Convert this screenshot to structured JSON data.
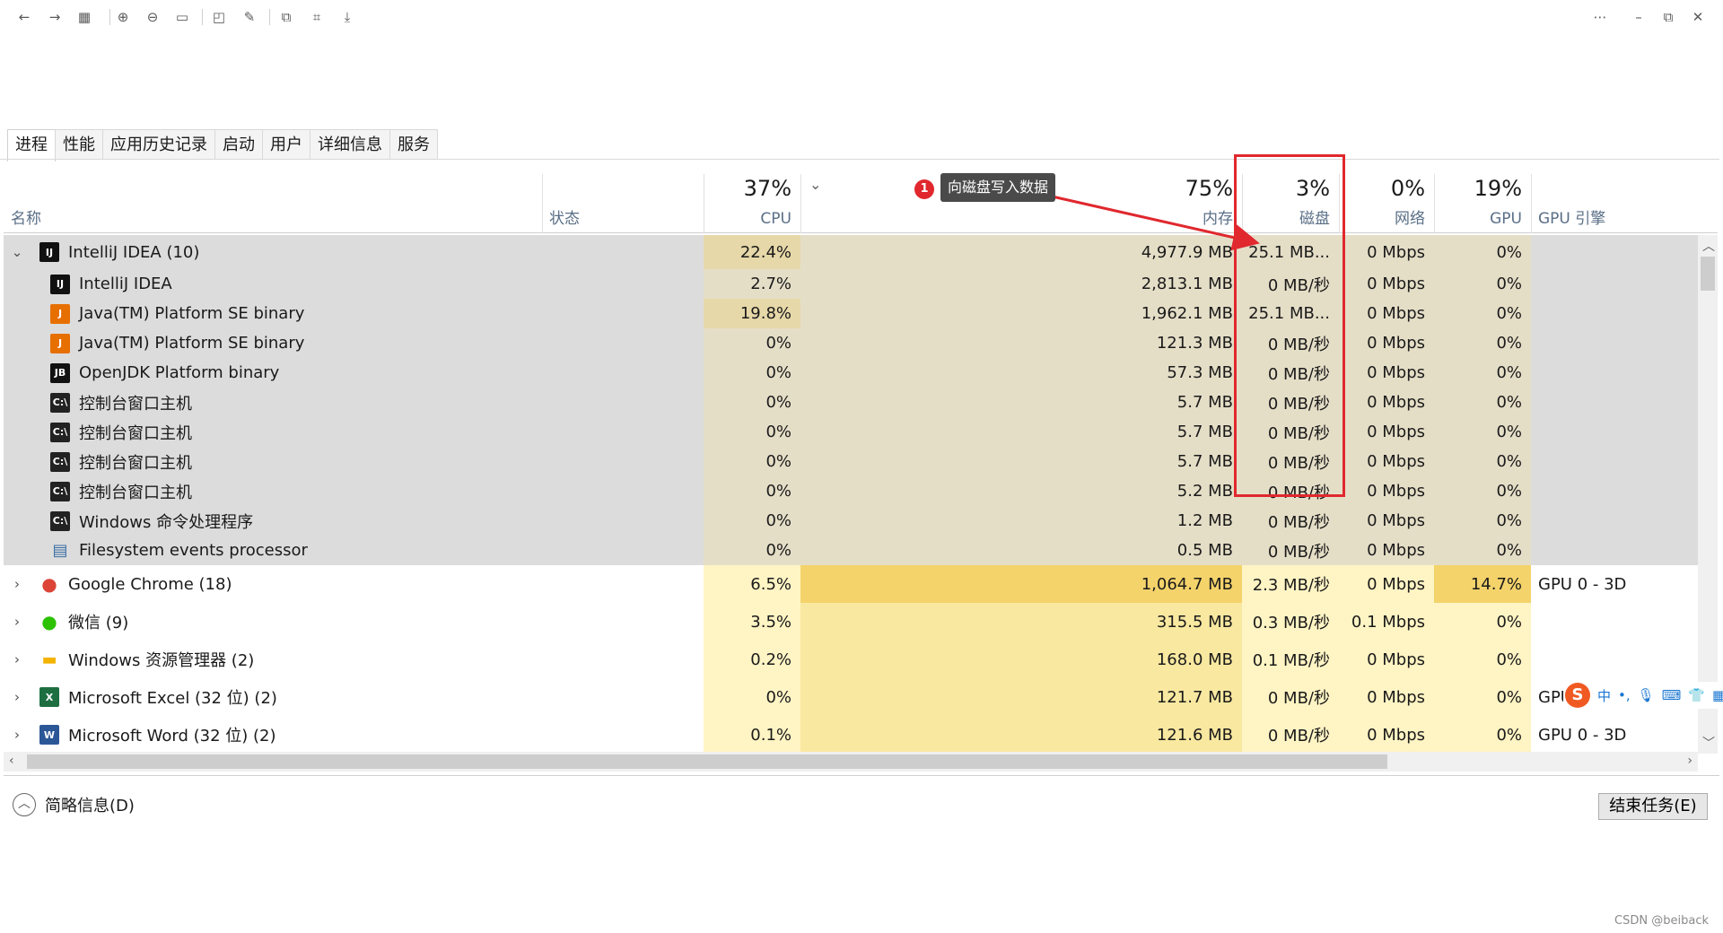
{
  "toolbar": {
    "icons": [
      "back-icon",
      "forward-icon",
      "grid-icon",
      "zoom-in-icon",
      "zoom-out-icon",
      "fit-icon",
      "open-icon",
      "edit-icon",
      "copy-icon",
      "capture-icon",
      "save-icon"
    ],
    "more": "⋯",
    "minimize": "–",
    "restore": "⧉",
    "close": "✕"
  },
  "tabs": [
    "进程",
    "性能",
    "应用历史记录",
    "启动",
    "用户",
    "详细信息",
    "服务"
  ],
  "header": {
    "name": "名称",
    "status": "状态",
    "cpu_pct": "37%",
    "cpu": "CPU",
    "mem_pct": "75%",
    "mem": "内存",
    "disk_pct": "3%",
    "disk": "磁盘",
    "net_pct": "0%",
    "net": "网络",
    "gpu_pct": "19%",
    "gpu": "GPU",
    "gpu_engine": "GPU 引擎"
  },
  "rows": [
    {
      "kind": "group",
      "expanded": true,
      "icon": "intellij-icon",
      "name": "IntelliJ IDEA (10)",
      "cpu": "22.4%",
      "mem": "4,977.9 MB",
      "disk": "25.1 MB...",
      "net": "0 Mbps",
      "gpu": "0%",
      "engine": ""
    },
    {
      "kind": "child",
      "icon": "intellij-icon",
      "name": "IntelliJ IDEA",
      "cpu": "2.7%",
      "mem": "2,813.1 MB",
      "disk": "0 MB/秒",
      "net": "0 Mbps",
      "gpu": "0%",
      "engine": ""
    },
    {
      "kind": "child",
      "icon": "java-icon",
      "name": "Java(TM) Platform SE binary",
      "cpu": "19.8%",
      "mem": "1,962.1 MB",
      "disk": "25.1 MB...",
      "net": "0 Mbps",
      "gpu": "0%",
      "engine": ""
    },
    {
      "kind": "child",
      "icon": "java-icon",
      "name": "Java(TM) Platform SE binary",
      "cpu": "0%",
      "mem": "121.3 MB",
      "disk": "0 MB/秒",
      "net": "0 Mbps",
      "gpu": "0%",
      "engine": ""
    },
    {
      "kind": "child",
      "icon": "jb-icon",
      "name": "OpenJDK Platform binary",
      "cpu": "0%",
      "mem": "57.3 MB",
      "disk": "0 MB/秒",
      "net": "0 Mbps",
      "gpu": "0%",
      "engine": ""
    },
    {
      "kind": "child",
      "icon": "console-icon",
      "name": "控制台窗口主机",
      "cpu": "0%",
      "mem": "5.7 MB",
      "disk": "0 MB/秒",
      "net": "0 Mbps",
      "gpu": "0%",
      "engine": ""
    },
    {
      "kind": "child",
      "icon": "console-icon",
      "name": "控制台窗口主机",
      "cpu": "0%",
      "mem": "5.7 MB",
      "disk": "0 MB/秒",
      "net": "0 Mbps",
      "gpu": "0%",
      "engine": ""
    },
    {
      "kind": "child",
      "icon": "console-icon",
      "name": "控制台窗口主机",
      "cpu": "0%",
      "mem": "5.7 MB",
      "disk": "0 MB/秒",
      "net": "0 Mbps",
      "gpu": "0%",
      "engine": ""
    },
    {
      "kind": "child",
      "icon": "console-icon",
      "name": "控制台窗口主机",
      "cpu": "0%",
      "mem": "5.2 MB",
      "disk": "0 MB/秒",
      "net": "0 Mbps",
      "gpu": "0%",
      "engine": ""
    },
    {
      "kind": "child",
      "icon": "console-icon",
      "name": "Windows 命令处理程序",
      "cpu": "0%",
      "mem": "1.2 MB",
      "disk": "0 MB/秒",
      "net": "0 Mbps",
      "gpu": "0%",
      "engine": ""
    },
    {
      "kind": "child",
      "icon": "window-icon",
      "name": "Filesystem events processor",
      "cpu": "0%",
      "mem": "0.5 MB",
      "disk": "0 MB/秒",
      "net": "0 Mbps",
      "gpu": "0%",
      "engine": ""
    },
    {
      "kind": "group",
      "expanded": false,
      "icon": "chrome-icon",
      "name": "Google Chrome (18)",
      "cpu": "6.5%",
      "mem": "1,064.7 MB",
      "disk": "2.3 MB/秒",
      "net": "0 Mbps",
      "gpu": "14.7%",
      "engine": "GPU 0 - 3D"
    },
    {
      "kind": "group",
      "expanded": false,
      "icon": "wechat-icon",
      "name": "微信 (9)",
      "cpu": "3.5%",
      "mem": "315.5 MB",
      "disk": "0.3 MB/秒",
      "net": "0.1 Mbps",
      "gpu": "0%",
      "engine": ""
    },
    {
      "kind": "group",
      "expanded": false,
      "icon": "explorer-icon",
      "name": "Windows 资源管理器 (2)",
      "cpu": "0.2%",
      "mem": "168.0 MB",
      "disk": "0.1 MB/秒",
      "net": "0 Mbps",
      "gpu": "0%",
      "engine": ""
    },
    {
      "kind": "group",
      "expanded": false,
      "icon": "excel-icon",
      "name": "Microsoft Excel (32 位) (2)",
      "cpu": "0%",
      "mem": "121.7 MB",
      "disk": "0 MB/秒",
      "net": "0 Mbps",
      "gpu": "0%",
      "engine": "GPU"
    },
    {
      "kind": "group",
      "expanded": false,
      "icon": "word-icon",
      "name": "Microsoft Word (32 位) (2)",
      "cpu": "0.1%",
      "mem": "121.6 MB",
      "disk": "0 MB/秒",
      "net": "0 Mbps",
      "gpu": "0%",
      "engine": "GPU 0 - 3D"
    }
  ],
  "annotation": {
    "marker": "1",
    "tooltip": "向磁盘写入数据"
  },
  "footer": {
    "brief": "简略信息(D)",
    "end_task": "结束任务(E)"
  },
  "ime": {
    "logo": "S",
    "lang": "中",
    "punct": "•,",
    "items": [
      "mic-icon",
      "keyboard-icon",
      "shirt-icon",
      "apps-icon"
    ]
  },
  "watermark": "CSDN @beiback",
  "colors": {
    "accent_red": "#e0282e",
    "heat_light": "#fff4c4",
    "heat_mid": "#f9e8a0",
    "heat_strong": "#f4d36b",
    "group_bg": "#dcdcdc"
  }
}
